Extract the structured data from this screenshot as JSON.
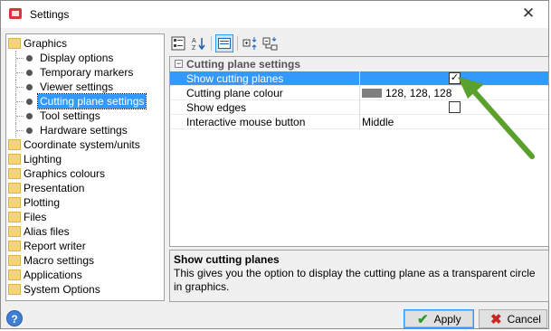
{
  "window": {
    "title": "Settings",
    "close_glyph": "✕"
  },
  "tree": {
    "items": [
      {
        "label": "Graphics",
        "kind": "folder",
        "level": 0
      },
      {
        "label": "Display options",
        "kind": "leaf",
        "level": 1
      },
      {
        "label": "Temporary markers",
        "kind": "leaf",
        "level": 1
      },
      {
        "label": "Viewer settings",
        "kind": "leaf",
        "level": 1
      },
      {
        "label": "Cutting plane settings",
        "kind": "leaf",
        "level": 1,
        "selected": true
      },
      {
        "label": "Tool settings",
        "kind": "leaf",
        "level": 1
      },
      {
        "label": "Hardware settings",
        "kind": "leaf",
        "level": 1
      },
      {
        "label": "Coordinate system/units",
        "kind": "folder",
        "level": 0
      },
      {
        "label": "Lighting",
        "kind": "folder",
        "level": 0
      },
      {
        "label": "Graphics colours",
        "kind": "folder",
        "level": 0
      },
      {
        "label": "Presentation",
        "kind": "folder",
        "level": 0
      },
      {
        "label": "Plotting",
        "kind": "folder",
        "level": 0
      },
      {
        "label": "Files",
        "kind": "folder",
        "level": 0
      },
      {
        "label": "Alias files",
        "kind": "folder",
        "level": 0
      },
      {
        "label": "Report writer",
        "kind": "folder",
        "level": 0
      },
      {
        "label": "Macro settings",
        "kind": "folder",
        "level": 0
      },
      {
        "label": "Applications",
        "kind": "folder",
        "level": 0
      },
      {
        "label": "System Options",
        "kind": "folder",
        "level": 0
      }
    ]
  },
  "toolbar": {
    "buttons": [
      {
        "icon": "categorized-icon",
        "active": false
      },
      {
        "icon": "sort-alphabetical-icon",
        "active": false
      },
      {
        "icon": "property-pages-icon",
        "active": true
      },
      {
        "icon": "expand-all-icon",
        "active": false
      },
      {
        "icon": "collapse-all-icon",
        "active": false
      }
    ]
  },
  "grid": {
    "category": {
      "label": "Cutting plane settings",
      "toggle": "−"
    },
    "rows": [
      {
        "name": "Show cutting planes",
        "type": "checkbox",
        "checked": true,
        "selected": true
      },
      {
        "name": "Cutting plane colour",
        "type": "color",
        "value": "128, 128, 128",
        "swatch": "#808080"
      },
      {
        "name": "Show edges",
        "type": "checkbox",
        "checked": false
      },
      {
        "name": "Interactive mouse button",
        "type": "text",
        "value": "Middle"
      }
    ]
  },
  "description": {
    "title": "Show cutting planes",
    "text": "This gives you the option to display the cutting plane as a transparent circle in graphics."
  },
  "footer": {
    "help_glyph": "?",
    "apply_label": "Apply",
    "cancel_label": "Cancel"
  },
  "colors": {
    "selection": "#3399ff",
    "arrow": "#5aa02c",
    "cancel_icon": "#cc2222",
    "apply_icon": "#2e9a2e"
  }
}
